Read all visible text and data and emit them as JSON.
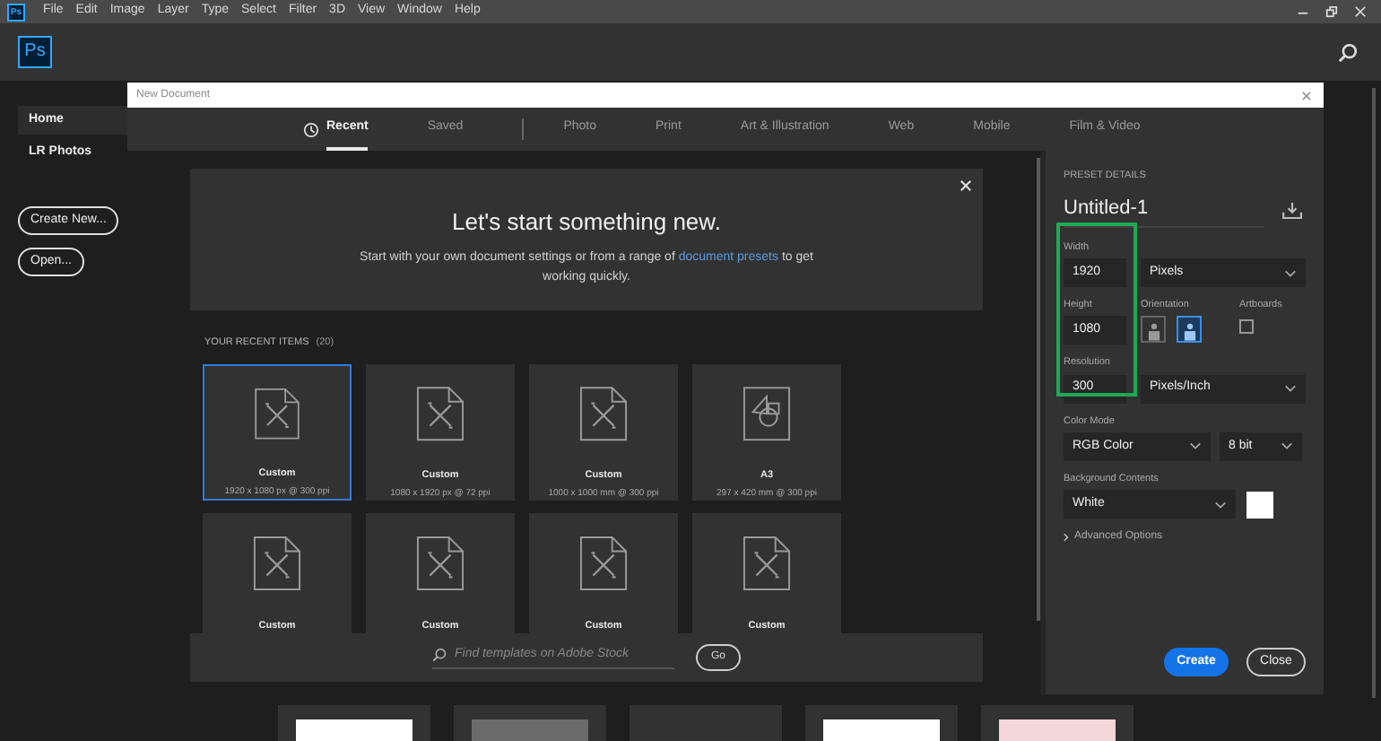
{
  "menu_bar": {
    "app_icon": "Ps",
    "items": [
      "File",
      "Edit",
      "Image",
      "Layer",
      "Type",
      "Select",
      "Filter",
      "3D",
      "View",
      "Window",
      "Help"
    ]
  },
  "header": {
    "logo": "Ps"
  },
  "sidebar": {
    "items": [
      {
        "label": "Home",
        "selected": true
      },
      {
        "label": "LR Photos",
        "selected": false
      }
    ],
    "buttons": [
      "Create New...",
      "Open..."
    ]
  },
  "dialog": {
    "title": "New Document",
    "tabs_personal": [
      {
        "label": "Recent",
        "selected": true
      },
      {
        "label": "Saved",
        "selected": false
      }
    ],
    "tabs_presets": [
      {
        "label": "Photo",
        "selected": false
      },
      {
        "label": "Print",
        "selected": false
      },
      {
        "label": "Art & Illustration",
        "selected": false
      },
      {
        "label": "Web",
        "selected": false
      },
      {
        "label": "Mobile",
        "selected": false
      },
      {
        "label": "Film & Video",
        "selected": false
      }
    ],
    "banner": {
      "title": "Let's start something new.",
      "text_before": "Start with your own document settings or from a range of",
      "link": "document presets",
      "text_after": "to get working quickly."
    },
    "recent": {
      "label": "YOUR RECENT ITEMS",
      "count": "(20)",
      "items": [
        {
          "kind": "custom",
          "name": "Custom",
          "details": "1920 x 1080 px @ 300 ppi",
          "selected": true
        },
        {
          "kind": "custom",
          "name": "Custom",
          "details": "1080 x 1920 px @ 72 ppi",
          "selected": false
        },
        {
          "kind": "custom",
          "name": "Custom",
          "details": "1000 x 1000 mm @ 300 ppi",
          "selected": false
        },
        {
          "kind": "shapes",
          "name": "A3",
          "details": "297 x 420 mm @ 300 ppi",
          "selected": false
        },
        {
          "kind": "custom",
          "name": "Custom",
          "selected": false
        },
        {
          "kind": "custom",
          "name": "Custom",
          "selected": false
        },
        {
          "kind": "custom",
          "name": "Custom",
          "selected": false
        },
        {
          "kind": "custom",
          "name": "Custom",
          "selected": false
        }
      ]
    },
    "search": {
      "placeholder": "Find templates on Adobe Stock",
      "button": "Go"
    },
    "preset": {
      "header": "PRESET DETAILS",
      "name": "Untitled-1",
      "width": {
        "label": "Width",
        "value": "1920",
        "unit": "Pixels"
      },
      "height": {
        "label": "Height",
        "value": "1080"
      },
      "orientation": {
        "label": "Orientation",
        "options": [
          {
            "selected": false
          },
          {
            "selected": true
          }
        ]
      },
      "artboards": {
        "label": "Artboards",
        "checked": false
      },
      "resolution": {
        "label": "Resolution",
        "value": "300",
        "unit": "Pixels/Inch"
      },
      "color_mode": {
        "label": "Color Mode",
        "value": "RGB Color",
        "depth": "8 bit"
      },
      "background": {
        "label": "Background Contents",
        "value": "White"
      },
      "advanced": "Advanced Options",
      "buttons": [
        "Create",
        "Close"
      ]
    }
  }
}
